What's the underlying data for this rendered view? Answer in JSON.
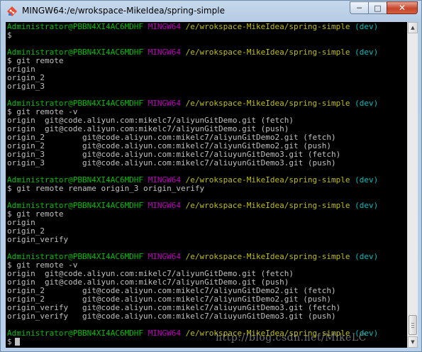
{
  "window": {
    "title": "MINGW64:/e/wrokspace-MikeIdea/spring-simple",
    "icon": "git-bash-icon",
    "controls": {
      "minimize": "minimize-icon",
      "maximize": "maximize-icon",
      "close": "close-icon"
    }
  },
  "prompt": {
    "user_host": "Administrator@PBBN4XI4AC6MDHF",
    "system": "MINGW64",
    "path": "/e/wrokspace-MikeIdea/spring-simple",
    "branch": "(dev)",
    "symbol": "$"
  },
  "terminal": {
    "lines": [
      {
        "kind": "prompt"
      },
      {
        "kind": "cmd",
        "text": "$"
      },
      {
        "kind": "blank"
      },
      {
        "kind": "prompt"
      },
      {
        "kind": "cmd",
        "text": "$ git remote"
      },
      {
        "kind": "out",
        "text": "origin"
      },
      {
        "kind": "out",
        "text": "origin_2"
      },
      {
        "kind": "out",
        "text": "origin_3"
      },
      {
        "kind": "blank"
      },
      {
        "kind": "prompt"
      },
      {
        "kind": "cmd",
        "text": "$ git remote -v"
      },
      {
        "kind": "out",
        "text": "origin  git@code.aliyun.com:mikelc7/aliyunGitDemo.git (fetch)"
      },
      {
        "kind": "out",
        "text": "origin  git@code.aliyun.com:mikelc7/aliyunGitDemo.git (push)"
      },
      {
        "kind": "out",
        "text": "origin_2        git@code.aliyun.com:mikelc7/aliyunGitDemo2.git (fetch)"
      },
      {
        "kind": "out",
        "text": "origin_2        git@code.aliyun.com:mikelc7/aliyunGitDemo2.git (push)"
      },
      {
        "kind": "out",
        "text": "origin_3        git@code.aliyun.com:mikelc7/aliuyunGitDemo3.git (fetch)"
      },
      {
        "kind": "out",
        "text": "origin_3        git@code.aliyun.com:mikelc7/aliuyunGitDemo3.git (push)"
      },
      {
        "kind": "blank"
      },
      {
        "kind": "prompt"
      },
      {
        "kind": "cmd",
        "text": "$ git remote rename origin_3 origin_verify"
      },
      {
        "kind": "blank"
      },
      {
        "kind": "prompt"
      },
      {
        "kind": "cmd",
        "text": "$ git remote"
      },
      {
        "kind": "out",
        "text": "origin"
      },
      {
        "kind": "out",
        "text": "origin_2"
      },
      {
        "kind": "out",
        "text": "origin_verify"
      },
      {
        "kind": "blank"
      },
      {
        "kind": "prompt"
      },
      {
        "kind": "cmd",
        "text": "$ git remote -v"
      },
      {
        "kind": "out",
        "text": "origin  git@code.aliyun.com:mikelc7/aliyunGitDemo.git (fetch)"
      },
      {
        "kind": "out",
        "text": "origin  git@code.aliyun.com:mikelc7/aliyunGitDemo.git (push)"
      },
      {
        "kind": "out",
        "text": "origin_2        git@code.aliyun.com:mikelc7/aliyunGitDemo2.git (fetch)"
      },
      {
        "kind": "out",
        "text": "origin_2        git@code.aliyun.com:mikelc7/aliyunGitDemo2.git (push)"
      },
      {
        "kind": "out",
        "text": "origin_verify   git@code.aliyun.com:mikelc7/aliuyunGitDemo3.git (fetch)"
      },
      {
        "kind": "out",
        "text": "origin_verify   git@code.aliyun.com:mikelc7/aliuyunGitDemo3.git (push)"
      },
      {
        "kind": "blank"
      },
      {
        "kind": "prompt"
      },
      {
        "kind": "cmd",
        "text": "$",
        "cursor": true
      }
    ]
  },
  "watermark": "http://blog.csdn.net/MikeLC",
  "colors": {
    "user_host": "#00bf00",
    "system": "#bf00bf",
    "path": "#bfbf00",
    "branch": "#00bfbf",
    "text": "#c0c0c0",
    "background": "#000000"
  }
}
